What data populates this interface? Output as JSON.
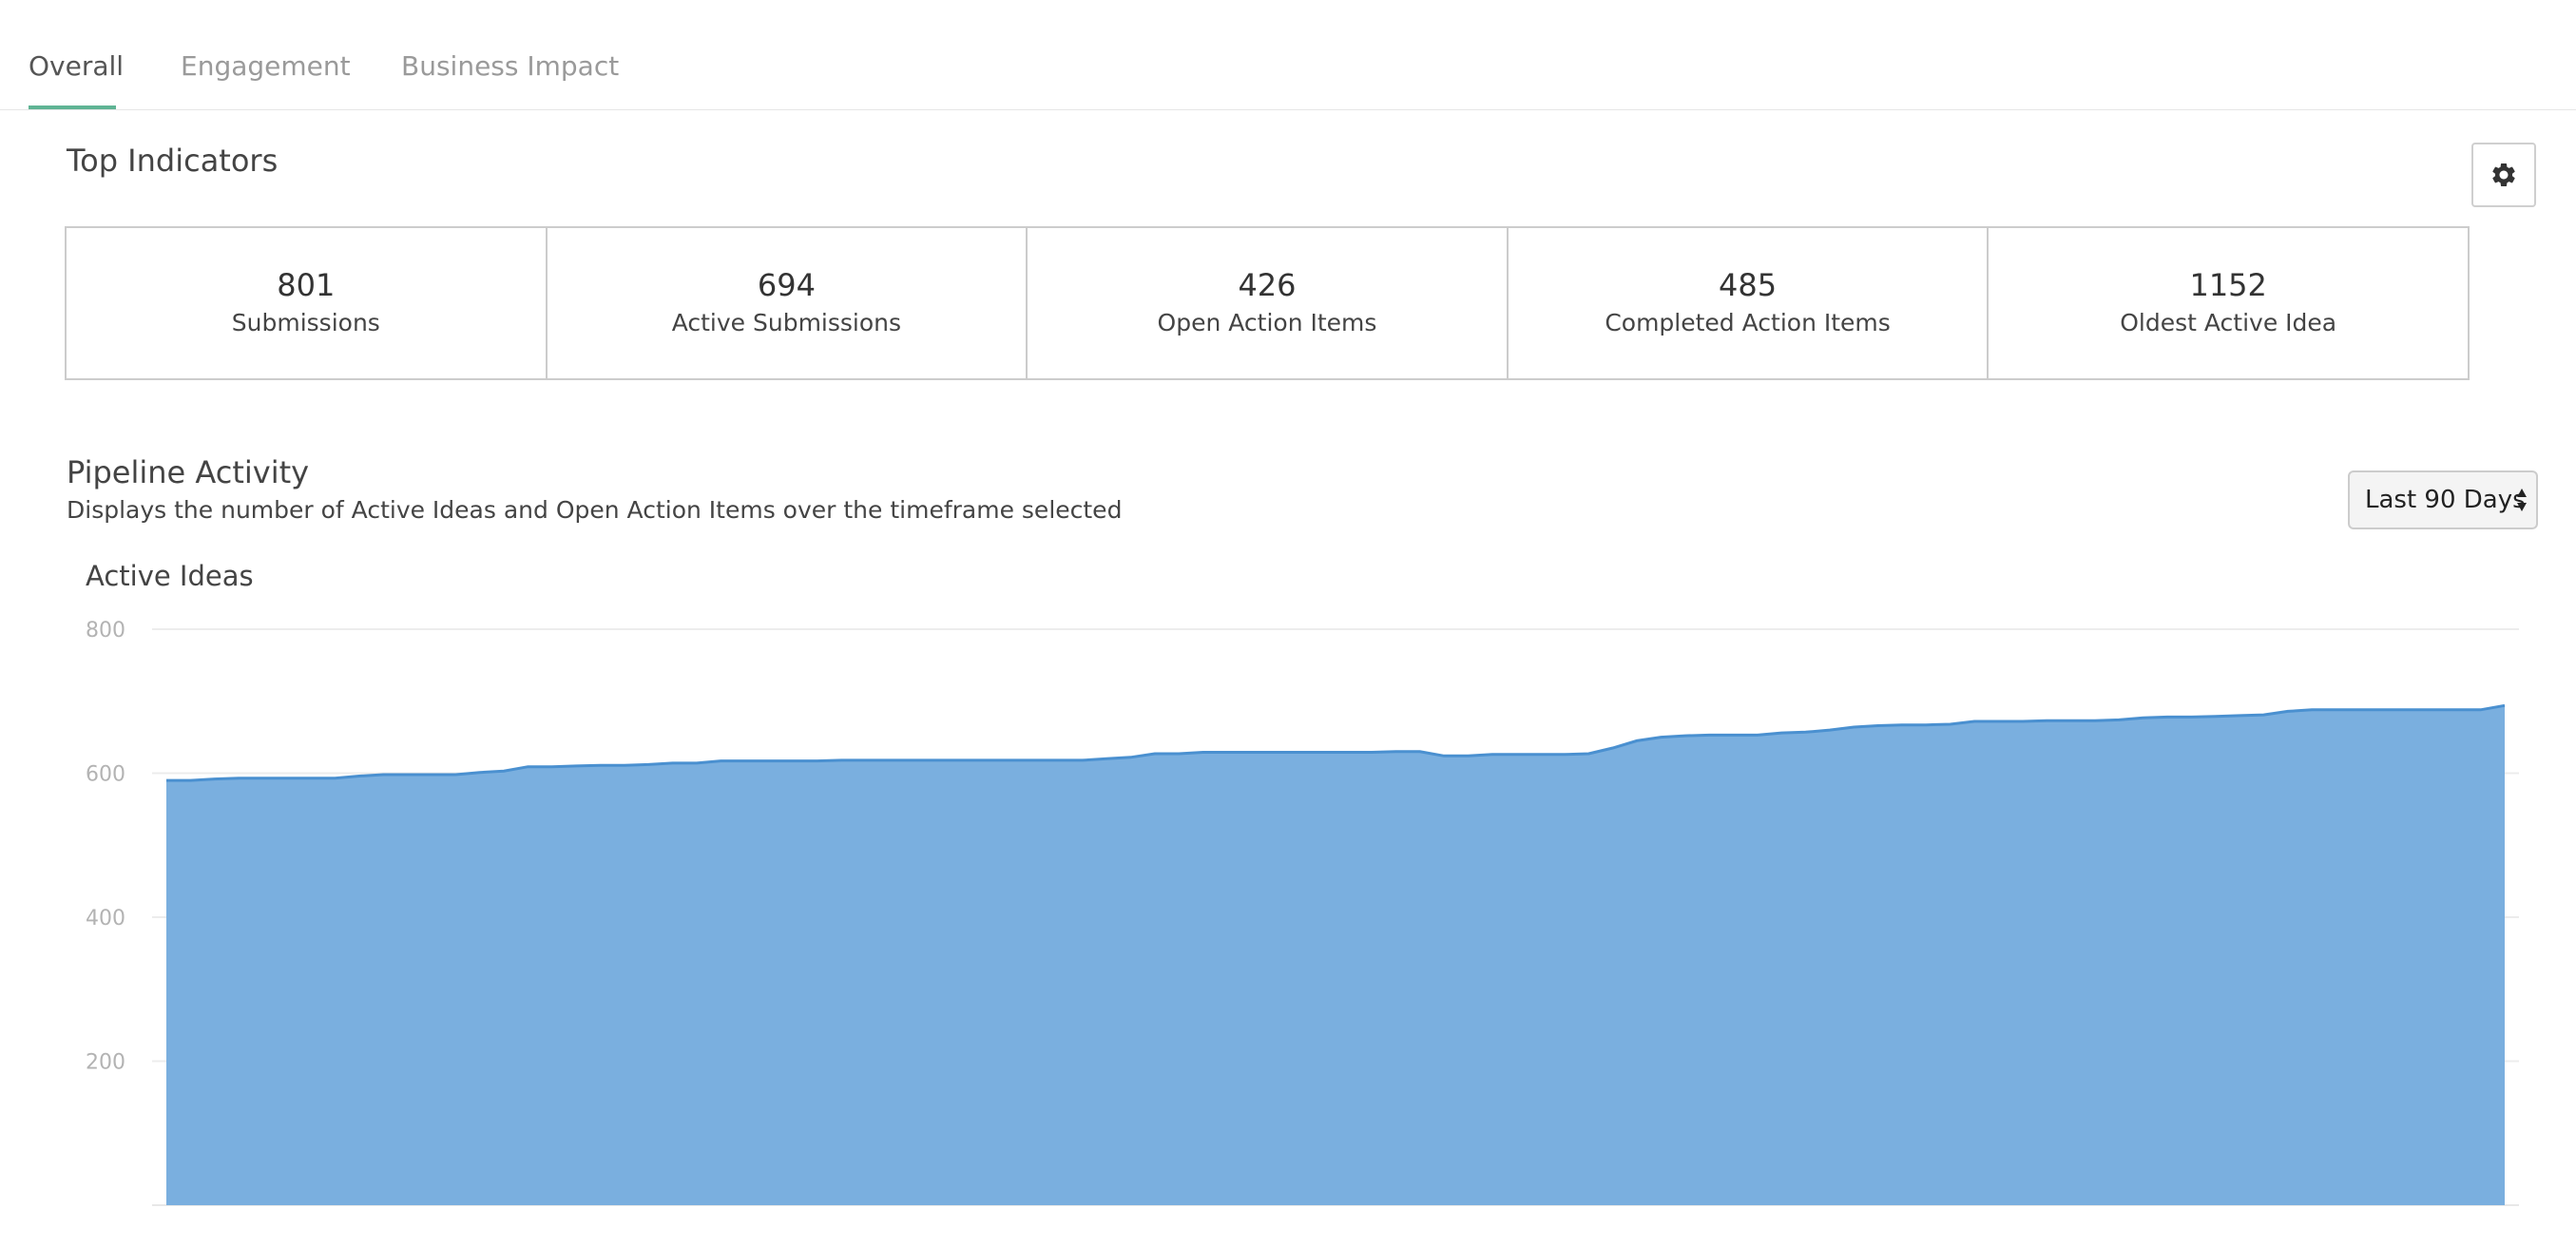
{
  "tabs": [
    {
      "label": "Overall",
      "active": true
    },
    {
      "label": "Engagement",
      "active": false
    },
    {
      "label": "Business Impact",
      "active": false
    }
  ],
  "top_indicators": {
    "title": "Top Indicators",
    "settings_icon": "gear-icon",
    "items": [
      {
        "value": "801",
        "label": "Submissions"
      },
      {
        "value": "694",
        "label": "Active Submissions"
      },
      {
        "value": "426",
        "label": "Open Action Items"
      },
      {
        "value": "485",
        "label": "Completed Action Items"
      },
      {
        "value": "1152",
        "label": "Oldest Active Idea"
      }
    ]
  },
  "pipeline": {
    "title": "Pipeline Activity",
    "subtitle": "Displays the number of Active Ideas and Open Action Items over the timeframe selected",
    "timeframe": "Last 90 Days"
  },
  "colors": {
    "accent": "#5fb494",
    "area_fill": "#7aafdf",
    "area_line": "#4a90d0"
  },
  "chart_data": {
    "type": "area",
    "title": "Active Ideas",
    "ylim": [
      0,
      800
    ],
    "yticks": [
      200,
      400,
      600,
      800
    ],
    "grid": true,
    "legend": "none",
    "series": [
      {
        "values": [
          590,
          590,
          592,
          593,
          593,
          593,
          593,
          593,
          596,
          598,
          598,
          598,
          598,
          601,
          603,
          609,
          609,
          610,
          611,
          611,
          612,
          614,
          614,
          617,
          617,
          617,
          617,
          617,
          618,
          618,
          618,
          618,
          618,
          618,
          618,
          618,
          618,
          618,
          618,
          620,
          622,
          627,
          627,
          629,
          629,
          629,
          629,
          629,
          629,
          629,
          629,
          630,
          630,
          624,
          624,
          626,
          626,
          626,
          626,
          627,
          635,
          645,
          650,
          652,
          653,
          653,
          653,
          656,
          657,
          660,
          664,
          666,
          667,
          667,
          668,
          672,
          672,
          672,
          673,
          673,
          673,
          674,
          677,
          678,
          678,
          679,
          680,
          681,
          686,
          688,
          688,
          688,
          688,
          688,
          688,
          688,
          688,
          694
        ]
      }
    ]
  }
}
